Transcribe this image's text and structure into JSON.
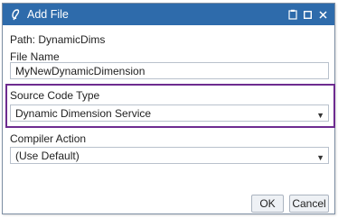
{
  "window": {
    "title": "Add File",
    "icons": [
      "app-logo-icon",
      "clipboard-icon",
      "maximize-icon",
      "close-icon"
    ],
    "titlebar_color": "#2e6bab"
  },
  "path": {
    "label": "Path:",
    "value": "DynamicDims"
  },
  "file_name": {
    "label": "File Name",
    "value": "MyNewDynamicDimension"
  },
  "source_code_type": {
    "label": "Source Code Type",
    "selected": "Dynamic Dimension Service",
    "highlight_color": "#6d2b8f"
  },
  "compiler_action": {
    "label": "Compiler Action",
    "selected": "(Use Default)"
  },
  "buttons": {
    "ok": "OK",
    "cancel": "Cancel"
  }
}
